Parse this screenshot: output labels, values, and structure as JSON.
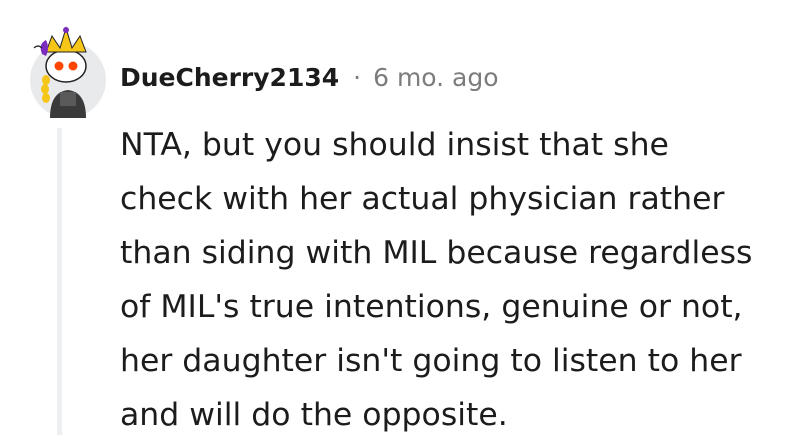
{
  "comment": {
    "author": "DueCherry2134",
    "separator": "·",
    "timestamp": "6 mo. ago",
    "body": "NTA, but you should insist that she\ncheck with her actual physician rather\nthan siding with MIL because regardless\nof MIL's true intentions, genuine or not,\nher daughter isn't going to listen to her\nand will do the opposite."
  },
  "avatar": {
    "icon": "snoo-avatar-icon",
    "colors": {
      "background": "#e9eaec",
      "skin": "#ffffff",
      "eyes": "#ff4500",
      "crown": "#f5c518",
      "hair_accent": "#7b2cbf",
      "outfit": "#3a3a3a"
    }
  }
}
